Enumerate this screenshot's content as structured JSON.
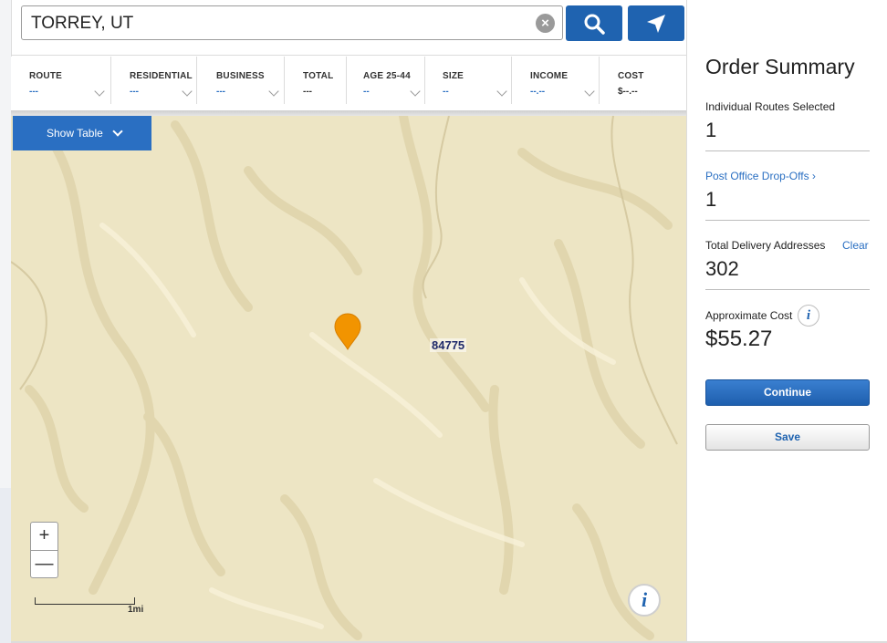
{
  "search": {
    "value": "TORREY, UT",
    "clear_icon": "clear-circle-icon",
    "search_icon": "magnifier-icon",
    "locate_icon": "location-arrow-icon"
  },
  "filters": [
    {
      "label": "ROUTE",
      "value": "---"
    },
    {
      "label": "RESIDENTIAL",
      "value": "---"
    },
    {
      "label": "BUSINESS",
      "value": "---"
    },
    {
      "label": "TOTAL",
      "value": "---"
    },
    {
      "label": "AGE 25-44",
      "value": "--"
    },
    {
      "label": "SIZE",
      "value": "--"
    },
    {
      "label": "INCOME",
      "value": "--.--"
    },
    {
      "label": "COST",
      "value": "$--.--"
    }
  ],
  "map": {
    "show_table_label": "Show Table",
    "zip_label": "84775",
    "zoom_in": "+",
    "zoom_out": "—",
    "scale_label": "1mi",
    "info_glyph": "i",
    "pin_color": "#f29400",
    "terrain_color": "#ede5c4"
  },
  "summary": {
    "title": "Order Summary",
    "routes_label": "Individual Routes Selected",
    "routes_value": "1",
    "po_link": "Post Office Drop-Offs ›",
    "po_value": "1",
    "total_label": "Total Delivery Addresses",
    "clear_link": "Clear",
    "total_value": "302",
    "cost_label": "Approximate Cost",
    "cost_info_glyph": "i",
    "cost_value": "$55.27",
    "continue_label": "Continue",
    "save_label": "Save"
  },
  "colors": {
    "accent": "#1f63b0",
    "link": "#2a6fc2"
  }
}
